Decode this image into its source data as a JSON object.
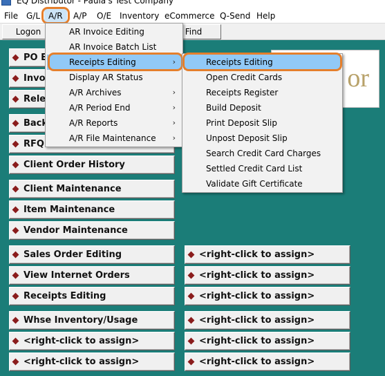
{
  "window": {
    "title": "EQ Distributor - Paula's Test Company"
  },
  "menubar": {
    "items": [
      "File",
      "G/L",
      "A/R",
      "A/P",
      "O/E",
      "Inventory",
      "eCommerce",
      "Q-Send",
      "Help"
    ],
    "active": "A/R"
  },
  "toolbar": {
    "logon": "Logon",
    "find": "Find"
  },
  "ar_menu": {
    "items": [
      {
        "label": "AR Invoice Editing",
        "submenu": false
      },
      {
        "label": "AR Invoice Batch List",
        "submenu": false
      },
      {
        "label": "Receipts Editing",
        "submenu": true,
        "highlighted": true
      },
      {
        "label": "Display AR Status",
        "submenu": false
      },
      {
        "label": "A/R Archives",
        "submenu": true
      },
      {
        "label": "A/R Period End",
        "submenu": true
      },
      {
        "label": "A/R Reports",
        "submenu": true
      },
      {
        "label": "A/R File Maintenance",
        "submenu": true
      }
    ],
    "arrow_glyph": "›"
  },
  "receipts_submenu": {
    "items": [
      "Receipts Editing",
      "Open Credit Cards",
      "Receipts Register",
      "Build Deposit",
      "Print Deposit Slip",
      "Unpost Deposit Slip",
      "Search Credit Card Charges",
      "Settled Credit Card List",
      "Validate Gift Certificate"
    ],
    "highlighted": "Receipts Editing"
  },
  "logo": {
    "text_fragment": "or"
  },
  "left_buttons": {
    "partial": [
      "PO E",
      "Invoi",
      "Rele",
      "Back",
      "RFQ"
    ],
    "labels": [
      "Client Order History",
      "Client Maintenance",
      "Item Maintenance",
      "Vendor Maintenance",
      "Sales Order Editing",
      "View Internet Orders",
      "Receipts Editing",
      "Whse Inventory/Usage",
      "<right-click to assign>",
      "<right-click to assign>"
    ]
  },
  "right_buttons": {
    "labels": [
      "<right-click to assign>",
      "<right-click to assign>",
      "<right-click to assign>",
      "<right-click to assign>",
      "<right-click to assign>",
      "<right-click to assign>"
    ]
  },
  "colors": {
    "background": "#1b7d78",
    "highlight_ring": "#e57f2c",
    "menu_highlight": "#91c9f7",
    "bullet": "#8a1c1c"
  }
}
